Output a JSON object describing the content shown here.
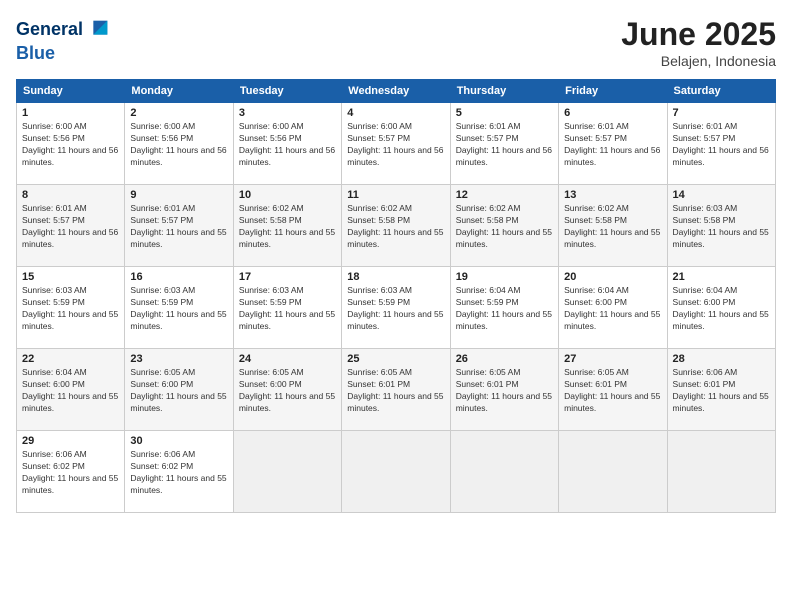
{
  "header": {
    "logo_line1": "General",
    "logo_line2": "Blue",
    "month": "June 2025",
    "location": "Belajen, Indonesia"
  },
  "days_of_week": [
    "Sunday",
    "Monday",
    "Tuesday",
    "Wednesday",
    "Thursday",
    "Friday",
    "Saturday"
  ],
  "weeks": [
    [
      {
        "day": "1",
        "sunrise": "Sunrise: 6:00 AM",
        "sunset": "Sunset: 5:56 PM",
        "daylight": "Daylight: 11 hours and 56 minutes."
      },
      {
        "day": "2",
        "sunrise": "Sunrise: 6:00 AM",
        "sunset": "Sunset: 5:56 PM",
        "daylight": "Daylight: 11 hours and 56 minutes."
      },
      {
        "day": "3",
        "sunrise": "Sunrise: 6:00 AM",
        "sunset": "Sunset: 5:56 PM",
        "daylight": "Daylight: 11 hours and 56 minutes."
      },
      {
        "day": "4",
        "sunrise": "Sunrise: 6:00 AM",
        "sunset": "Sunset: 5:57 PM",
        "daylight": "Daylight: 11 hours and 56 minutes."
      },
      {
        "day": "5",
        "sunrise": "Sunrise: 6:01 AM",
        "sunset": "Sunset: 5:57 PM",
        "daylight": "Daylight: 11 hours and 56 minutes."
      },
      {
        "day": "6",
        "sunrise": "Sunrise: 6:01 AM",
        "sunset": "Sunset: 5:57 PM",
        "daylight": "Daylight: 11 hours and 56 minutes."
      },
      {
        "day": "7",
        "sunrise": "Sunrise: 6:01 AM",
        "sunset": "Sunset: 5:57 PM",
        "daylight": "Daylight: 11 hours and 56 minutes."
      }
    ],
    [
      {
        "day": "8",
        "sunrise": "Sunrise: 6:01 AM",
        "sunset": "Sunset: 5:57 PM",
        "daylight": "Daylight: 11 hours and 56 minutes."
      },
      {
        "day": "9",
        "sunrise": "Sunrise: 6:01 AM",
        "sunset": "Sunset: 5:57 PM",
        "daylight": "Daylight: 11 hours and 55 minutes."
      },
      {
        "day": "10",
        "sunrise": "Sunrise: 6:02 AM",
        "sunset": "Sunset: 5:58 PM",
        "daylight": "Daylight: 11 hours and 55 minutes."
      },
      {
        "day": "11",
        "sunrise": "Sunrise: 6:02 AM",
        "sunset": "Sunset: 5:58 PM",
        "daylight": "Daylight: 11 hours and 55 minutes."
      },
      {
        "day": "12",
        "sunrise": "Sunrise: 6:02 AM",
        "sunset": "Sunset: 5:58 PM",
        "daylight": "Daylight: 11 hours and 55 minutes."
      },
      {
        "day": "13",
        "sunrise": "Sunrise: 6:02 AM",
        "sunset": "Sunset: 5:58 PM",
        "daylight": "Daylight: 11 hours and 55 minutes."
      },
      {
        "day": "14",
        "sunrise": "Sunrise: 6:03 AM",
        "sunset": "Sunset: 5:58 PM",
        "daylight": "Daylight: 11 hours and 55 minutes."
      }
    ],
    [
      {
        "day": "15",
        "sunrise": "Sunrise: 6:03 AM",
        "sunset": "Sunset: 5:59 PM",
        "daylight": "Daylight: 11 hours and 55 minutes."
      },
      {
        "day": "16",
        "sunrise": "Sunrise: 6:03 AM",
        "sunset": "Sunset: 5:59 PM",
        "daylight": "Daylight: 11 hours and 55 minutes."
      },
      {
        "day": "17",
        "sunrise": "Sunrise: 6:03 AM",
        "sunset": "Sunset: 5:59 PM",
        "daylight": "Daylight: 11 hours and 55 minutes."
      },
      {
        "day": "18",
        "sunrise": "Sunrise: 6:03 AM",
        "sunset": "Sunset: 5:59 PM",
        "daylight": "Daylight: 11 hours and 55 minutes."
      },
      {
        "day": "19",
        "sunrise": "Sunrise: 6:04 AM",
        "sunset": "Sunset: 5:59 PM",
        "daylight": "Daylight: 11 hours and 55 minutes."
      },
      {
        "day": "20",
        "sunrise": "Sunrise: 6:04 AM",
        "sunset": "Sunset: 6:00 PM",
        "daylight": "Daylight: 11 hours and 55 minutes."
      },
      {
        "day": "21",
        "sunrise": "Sunrise: 6:04 AM",
        "sunset": "Sunset: 6:00 PM",
        "daylight": "Daylight: 11 hours and 55 minutes."
      }
    ],
    [
      {
        "day": "22",
        "sunrise": "Sunrise: 6:04 AM",
        "sunset": "Sunset: 6:00 PM",
        "daylight": "Daylight: 11 hours and 55 minutes."
      },
      {
        "day": "23",
        "sunrise": "Sunrise: 6:05 AM",
        "sunset": "Sunset: 6:00 PM",
        "daylight": "Daylight: 11 hours and 55 minutes."
      },
      {
        "day": "24",
        "sunrise": "Sunrise: 6:05 AM",
        "sunset": "Sunset: 6:00 PM",
        "daylight": "Daylight: 11 hours and 55 minutes."
      },
      {
        "day": "25",
        "sunrise": "Sunrise: 6:05 AM",
        "sunset": "Sunset: 6:01 PM",
        "daylight": "Daylight: 11 hours and 55 minutes."
      },
      {
        "day": "26",
        "sunrise": "Sunrise: 6:05 AM",
        "sunset": "Sunset: 6:01 PM",
        "daylight": "Daylight: 11 hours and 55 minutes."
      },
      {
        "day": "27",
        "sunrise": "Sunrise: 6:05 AM",
        "sunset": "Sunset: 6:01 PM",
        "daylight": "Daylight: 11 hours and 55 minutes."
      },
      {
        "day": "28",
        "sunrise": "Sunrise: 6:06 AM",
        "sunset": "Sunset: 6:01 PM",
        "daylight": "Daylight: 11 hours and 55 minutes."
      }
    ],
    [
      {
        "day": "29",
        "sunrise": "Sunrise: 6:06 AM",
        "sunset": "Sunset: 6:02 PM",
        "daylight": "Daylight: 11 hours and 55 minutes."
      },
      {
        "day": "30",
        "sunrise": "Sunrise: 6:06 AM",
        "sunset": "Sunset: 6:02 PM",
        "daylight": "Daylight: 11 hours and 55 minutes."
      },
      null,
      null,
      null,
      null,
      null
    ]
  ]
}
